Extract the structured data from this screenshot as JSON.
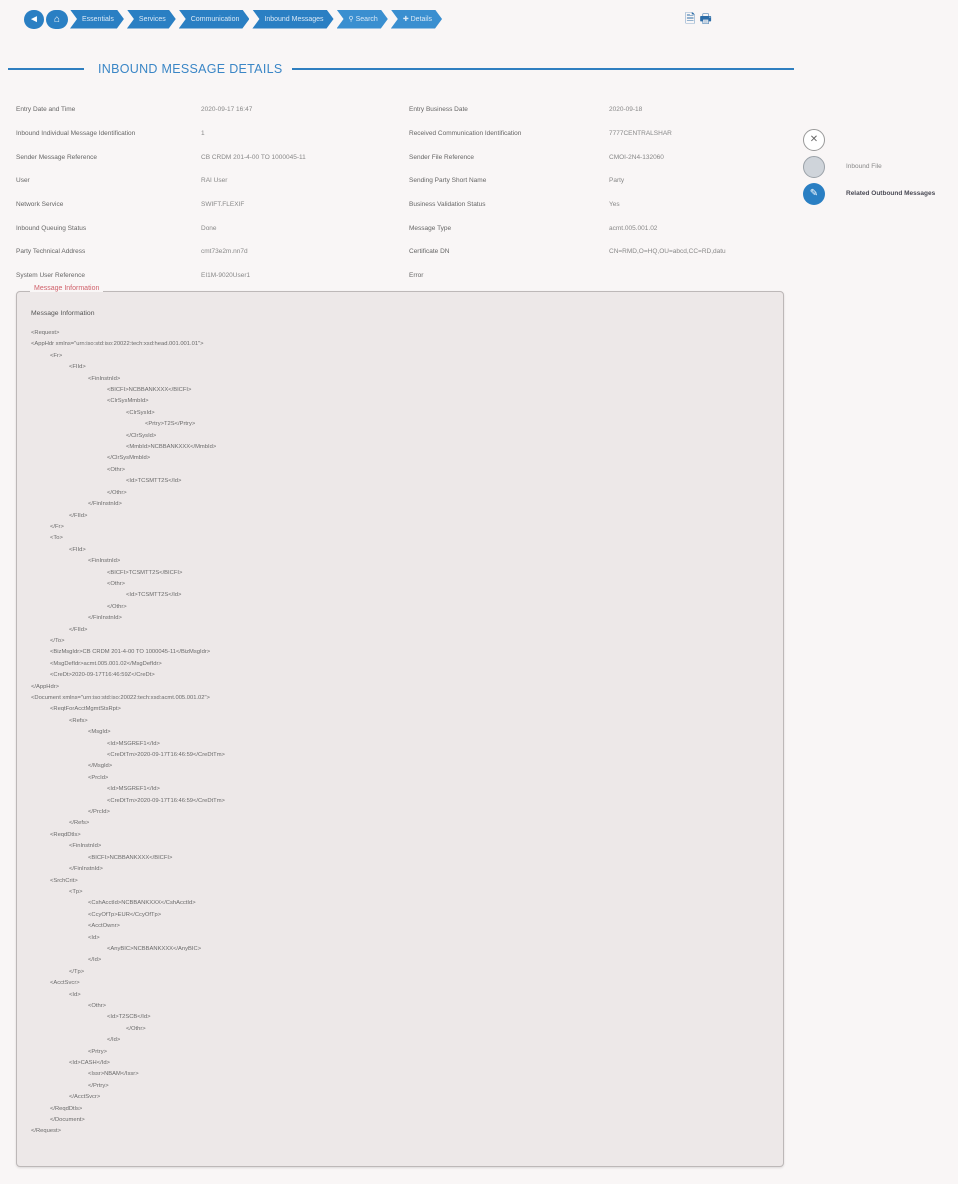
{
  "breadcrumb": {
    "items": [
      "Essentials",
      "Services",
      "Communication",
      "Inbound Messages"
    ],
    "search_label": "Search",
    "details_label": "Details"
  },
  "section_title": "INBOUND MESSAGE DETAILS",
  "details": [
    {
      "label": "Entry Date and Time",
      "value": "2020-09-17 16:47",
      "label2": "Entry Business Date",
      "value2": "2020-09-18"
    },
    {
      "label": "Inbound Individual Message Identification",
      "value": "1",
      "label2": "Received Communication Identification",
      "value2": "7777CENTRALSHAR"
    },
    {
      "label": "Sender Message Reference",
      "value": "CB CRDM 201-4-00 TO 1000045-11",
      "label2": "Sender File Reference",
      "value2": "CMOI-2N4-132060"
    },
    {
      "label": "User",
      "value": "RAI User",
      "label2": "Sending Party Short Name",
      "value2": "Party"
    },
    {
      "label": "Network Service",
      "value": "SWIFT.FLEXIF",
      "label2": "Business Validation Status",
      "value2": "Yes"
    },
    {
      "label": "Inbound Queuing Status",
      "value": "Done",
      "label2": "Message Type",
      "value2": "acmt.005.001.02"
    },
    {
      "label": "Party Technical Address",
      "value": "cmt73e2m.nn7d",
      "label2": "Certificate DN",
      "value2": "CN=RMD,O=HQ,OU=abcd,CC=RD,datu"
    },
    {
      "label": "System User Reference",
      "value": "EI1M-9020User1",
      "label2": "Error",
      "value2": ""
    }
  ],
  "side_panel": {
    "items": [
      {
        "label": "",
        "icon": "close-icon"
      },
      {
        "label": "Inbound File",
        "icon": "file-circle-icon"
      },
      {
        "label": "Related Outbound Messages",
        "icon": "link-icon"
      }
    ]
  },
  "message_information": {
    "legend": "Message Information",
    "heading": "Message Information",
    "lines": [
      "<Request>",
      "<AppHdr xmlns=\"urn:iso:std:iso:20022:tech:xsd:head.001.001.01\">",
      "<Fr>",
      "<FIId>",
      "<FinInstnId>",
      "<BICFI>NCBBANKXXX</BICFI>",
      "<ClrSysMmbId>",
      "<ClrSysId>",
      "<Prtry>T2S</Prtry>",
      "</ClrSysId>",
      "<MmbId>NCBBANKXXX</MmbId>",
      "</ClrSysMmbId>",
      "<Othr>",
      "<Id>TCSMTT2S</Id>",
      "</Othr>",
      "</FinInstnId>",
      "</FIId>",
      "</Fr>",
      "<To>",
      "<FIId>",
      "<FinInstnId>",
      "<BICFI>TCSMTT2S</BICFI>",
      "<Othr>",
      "<Id>TCSMTT2S</Id>",
      "</Othr>",
      "</FinInstnId>",
      "</FIId>",
      "</To>",
      "<BizMsgIdr>CB CRDM 201-4-00 TO 1000045-11</BizMsgIdr>",
      "<MsgDefIdr>acmt.005.001.02</MsgDefIdr>",
      "<CreDt>2020-09-17T16:46:59Z</CreDt>",
      "</AppHdr>",
      "<Document xmlns=\"urn:iso:std:iso:20022:tech:xsd:acmt.005.001.02\">",
      "<ReqtForAcctMgmtStsRpt>",
      "<Refs>",
      "<MsgId>",
      "<Id>MSGREF1</Id>",
      "<CreDtTm>2020-09-17T16:46:59</CreDtTm>",
      "</MsgId>",
      "<PrcId>",
      "<Id>MSGREF1</Id>",
      "<CreDtTm>2020-09-17T16:46:59</CreDtTm>",
      "</PrcId>",
      "</Refs>",
      "<ReqdDtls>",
      "<FinInstnId>",
      "<BICFI>NCBBANKXXX</BICFI>",
      "</FinInstnId>",
      "<SrchCrit>",
      "<Tp>",
      "<CshAcctId>NCBBANKXXX</CshAcctId>",
      "<CcyOfTp>EUR</CcyOfTp>",
      "<AcctOwnr>",
      "<Id>",
      "<AnyBIC>NCBBANKXXX</AnyBIC>",
      "</Id>",
      "</Tp>",
      "<AcctSvcr>",
      "<Id>",
      "<Othr>",
      "<Id>T2SCB</Id>",
      "</Othr>",
      "</Id>",
      "<Prtry>",
      "<Id>CASH</Id>",
      "<Issr>NBAM</Issr>",
      "</Prtry>",
      "</AcctSvcr>",
      "</ReqdDtls>",
      "</Document>",
      "</Request>"
    ],
    "indents": [
      0,
      0,
      1,
      2,
      3,
      4,
      4,
      5,
      6,
      5,
      5,
      4,
      4,
      5,
      4,
      3,
      2,
      1,
      1,
      2,
      3,
      4,
      4,
      5,
      4,
      3,
      2,
      1,
      1,
      1,
      1,
      0,
      0,
      1,
      2,
      3,
      4,
      4,
      3,
      3,
      4,
      4,
      3,
      2,
      1,
      2,
      3,
      2,
      1,
      2,
      3,
      3,
      3,
      3,
      4,
      3,
      2,
      1,
      2,
      3,
      4,
      5,
      4,
      3,
      2,
      3,
      3,
      2,
      1,
      1,
      0,
      0
    ]
  }
}
